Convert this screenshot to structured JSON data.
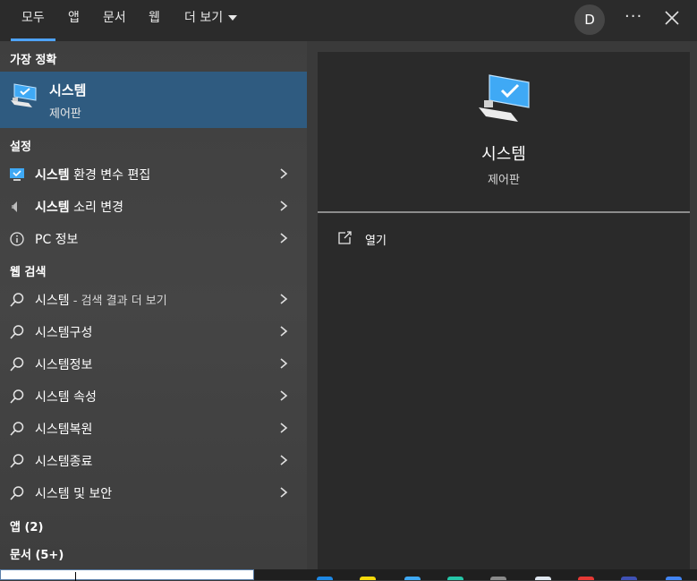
{
  "tabs": [
    {
      "label": "모두"
    },
    {
      "label": "앱"
    },
    {
      "label": "문서"
    },
    {
      "label": "웹"
    },
    {
      "label": "더 보기"
    }
  ],
  "account": {
    "initial": "D"
  },
  "menu": {
    "more": "···"
  },
  "best_match": {
    "heading": "가장 정확",
    "title": "시스템",
    "subtitle": "제어판"
  },
  "settings": {
    "heading": "설정",
    "items": [
      {
        "bold": "시스템",
        "rest": " 환경 변수 편집"
      },
      {
        "bold": "시스템",
        "rest": " 소리 변경"
      },
      {
        "bold": "",
        "rest": "PC 정보"
      }
    ]
  },
  "web": {
    "heading": "웹 검색",
    "first": {
      "label": "시스템",
      "sub": " - 검색 결과 더 보기"
    },
    "items": [
      {
        "label": "시스템구성"
      },
      {
        "label": "시스템정보"
      },
      {
        "label": "시스템 속성"
      },
      {
        "label": "시스템복원"
      },
      {
        "label": "시스템종료"
      },
      {
        "label": "시스템 및 보안"
      }
    ]
  },
  "apps": {
    "heading": "앱 (2)"
  },
  "docs": {
    "heading": "문서 (5+)"
  },
  "preview": {
    "title": "시스템",
    "subtitle": "제어판",
    "open_label": "열기"
  },
  "colors": {
    "accent": "#4ea3ff",
    "selected": "#2f5b80"
  }
}
